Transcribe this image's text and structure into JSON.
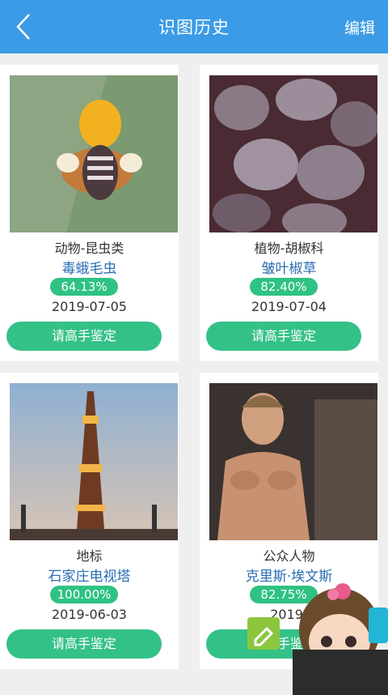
{
  "header": {
    "title": "识图历史",
    "edit_label": "编辑"
  },
  "cards": [
    {
      "category": "动物-昆虫类",
      "name": "毒蛾毛虫",
      "confidence": "64.13%",
      "date": "2019-07-05",
      "button_label": "请高手鉴定"
    },
    {
      "category": "植物-胡椒科",
      "name": "皱叶椒草",
      "confidence": "82.40%",
      "date": "2019-07-04",
      "button_label": "请高手鉴定"
    },
    {
      "category": "地标",
      "name": "石家庄电视塔",
      "confidence": "100.00%",
      "date": "2019-06-03",
      "button_label": "请高手鉴定"
    },
    {
      "category": "公众人物",
      "name": "克里斯·埃文斯",
      "confidence": "82.75%",
      "date": "2019-",
      "button_label": "请高手鉴定"
    }
  ],
  "colors": {
    "header": "#3c9be6",
    "badge": "#2fc283",
    "button": "#34c188",
    "name_text": "#2a6db3"
  }
}
